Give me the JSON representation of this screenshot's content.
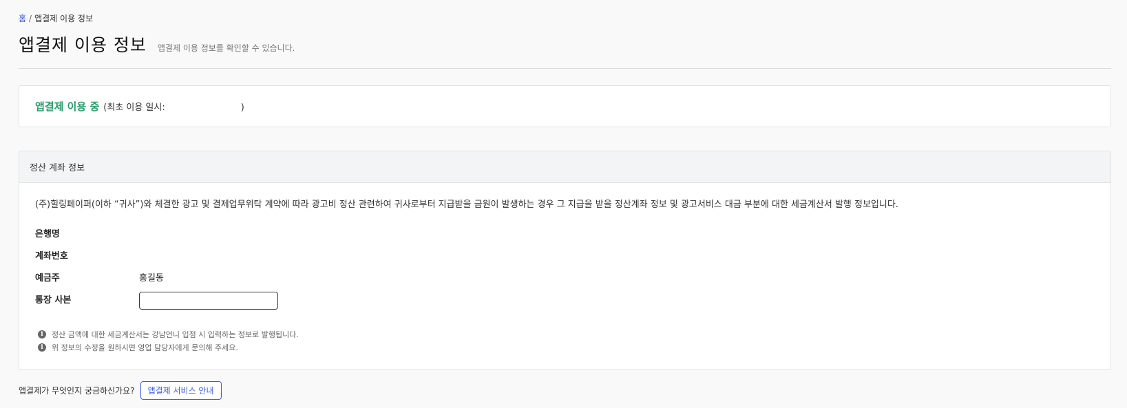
{
  "breadcrumb": {
    "home": "홈",
    "separator": "/",
    "current": "앱결제 이용 정보"
  },
  "header": {
    "title": "앱결제 이용 정보",
    "subtitle": "앱결제 이용 정보를 확인할 수 있습니다."
  },
  "status": {
    "label": "앱결제 이용 중",
    "detail_prefix": "(최초 이용 일시:",
    "detail_suffix": ")",
    "label_color": "#2a9a6a"
  },
  "account": {
    "title": "정산 계좌 정보",
    "description": "(주)힐링페이퍼(이하 “귀사”)와 체결한 광고 및 결제업무위탁 계약에 따라 광고비 정산 관련하여 귀사로부터 지급받을 금원이 발생하는 경우 그 지급을 받을 정산계좌 정보 및 광고서비스 대금 부분에 대한 세금계산서 발행 정보입니다.",
    "fields": {
      "bank_label": "은행명",
      "bank_value": "",
      "account_number_label": "계좌번호",
      "account_number_value": "",
      "holder_label": "예금주",
      "holder_value": "홍길동",
      "passbook_label": "통장 사본"
    },
    "notes": [
      "정산 금액에 대한 세금계산서는 강남언니 입점 시 입력하는 정보로 발행됩니다.",
      "위 정보의 수정을 원하시면 영업 담당자에게 문의해 주세요."
    ],
    "note_icon": "info-icon"
  },
  "footer": {
    "question": "앱결제가 무엇인지 궁금하신가요?",
    "guide_button": "앱결제 서비스 안내",
    "accent_color": "#3b5bdb"
  }
}
